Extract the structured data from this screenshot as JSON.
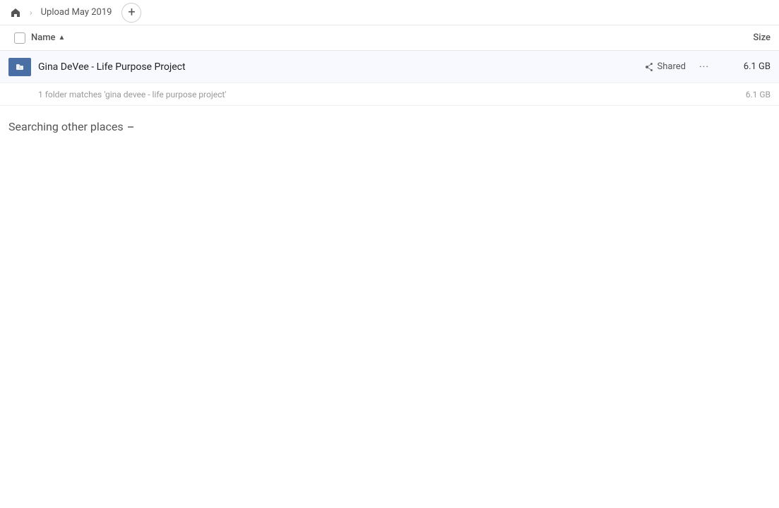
{
  "topbar": {
    "home_label": "Home",
    "breadcrumb_label": "Upload May 2019",
    "add_button_label": "+"
  },
  "column_headers": {
    "name_label": "Name",
    "size_label": "Size"
  },
  "file_row": {
    "name": "Gina DeVee - Life Purpose Project",
    "shared_label": "Shared",
    "size": "6.1 GB",
    "more_label": "···"
  },
  "summary_row": {
    "text": "1 folder matches 'gina devee - life purpose project'",
    "size": "6.1 GB"
  },
  "searching_section": {
    "label": "Searching other places",
    "spinner": true
  }
}
